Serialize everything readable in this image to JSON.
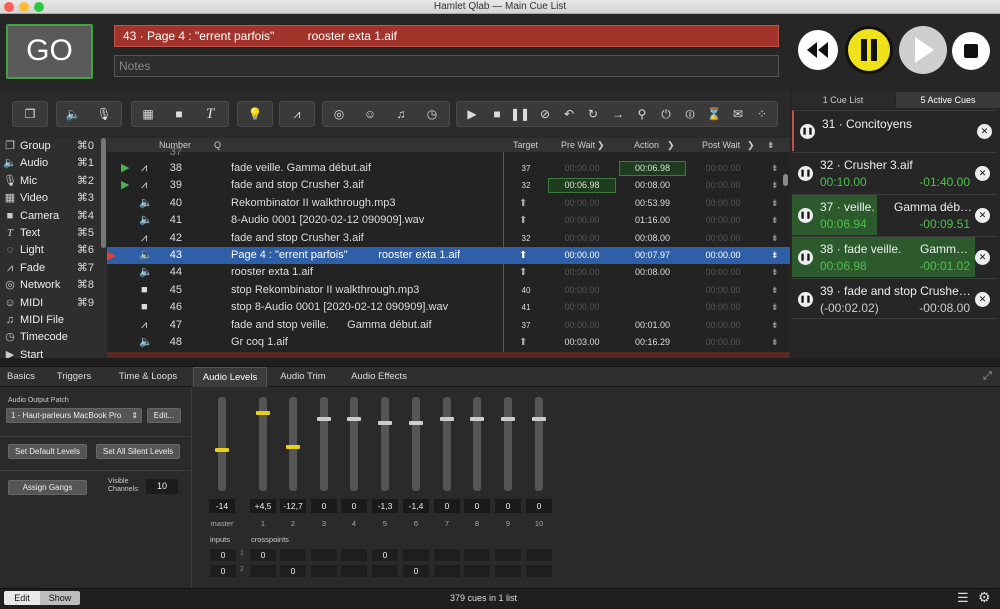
{
  "window": {
    "title": "Hamlet Qlab — Main Cue List"
  },
  "header": {
    "go_label": "GO",
    "standby_text": "43 · Page 4 : \"errent parfois\"          rooster exta 1.aif",
    "notes_placeholder": "Notes"
  },
  "sidebar": {
    "items": [
      {
        "label": "Group",
        "key": "⌘0",
        "icon": "group-icon"
      },
      {
        "label": "Audio",
        "key": "⌘1",
        "icon": "audio-icon"
      },
      {
        "label": "Mic",
        "key": "⌘2",
        "icon": "mic-icon"
      },
      {
        "label": "Video",
        "key": "⌘3",
        "icon": "video-icon"
      },
      {
        "label": "Camera",
        "key": "⌘4",
        "icon": "camera-icon"
      },
      {
        "label": "Text",
        "key": "⌘5",
        "icon": "text-icon"
      },
      {
        "label": "Light",
        "key": "⌘6",
        "icon": "light-icon"
      },
      {
        "label": "Fade",
        "key": "⌘7",
        "icon": "fade-icon"
      },
      {
        "label": "Network",
        "key": "⌘8",
        "icon": "network-icon"
      },
      {
        "label": "MIDI",
        "key": "⌘9",
        "icon": "midi-icon"
      },
      {
        "label": "MIDI File",
        "key": "",
        "icon": "midi-file-icon"
      },
      {
        "label": "Timecode",
        "key": "",
        "icon": "timecode-icon"
      },
      {
        "label": "Start",
        "key": "",
        "icon": "start-icon"
      }
    ]
  },
  "table": {
    "headers": {
      "number": "Number",
      "q": "Q",
      "target": "Target",
      "pre_wait": "Pre Wait",
      "action": "Action",
      "post_wait": "Post Wait"
    },
    "rows": [
      {
        "num": "37",
        "q": "",
        "target": "",
        "pre": "",
        "action": "",
        "post": ""
      },
      {
        "num": "38",
        "q": "fade veille.      Gamma début.aif",
        "target": "37",
        "pre": "00:00.00",
        "action": "00:06.98",
        "post": "00:00.00"
      },
      {
        "num": "39",
        "q": "fade and stop Crusher 3.aif",
        "target": "32",
        "pre": "00:06.98",
        "action": "00:08.00",
        "post": "00:00.00"
      },
      {
        "num": "40",
        "q": "Rekombinator II walkthrough.mp3",
        "target": "",
        "pre": "00:00.00",
        "action": "00:53.99",
        "post": "00:00.00"
      },
      {
        "num": "41",
        "q": "8-Audio 0001 [2020-02-12 090909].wav",
        "target": "",
        "pre": "00:00.00",
        "action": "01:16.00",
        "post": "00:00.00"
      },
      {
        "num": "42",
        "q": "fade and stop Crusher 3.aif",
        "target": "32",
        "pre": "00:00.00",
        "action": "00:08.00",
        "post": "00:00.00"
      },
      {
        "num": "43",
        "q": "Page 4 : \"errent parfois\"          rooster exta 1.aif",
        "target": "",
        "pre": "00:00.00",
        "action": "00:07.97",
        "post": "00:00.00"
      },
      {
        "num": "44",
        "q": "rooster exta 1.aif",
        "target": "",
        "pre": "00:00.00",
        "action": "00:08.00",
        "post": "00:00.00"
      },
      {
        "num": "45",
        "q": "stop Rekombinator II walkthrough.mp3",
        "target": "40",
        "pre": "00:00.00",
        "action": "",
        "post": "00:00.00"
      },
      {
        "num": "46",
        "q": "stop 8-Audio 0001 [2020-02-12 090909].wav",
        "target": "41",
        "pre": "00:00.00",
        "action": "",
        "post": "00:00.00"
      },
      {
        "num": "47",
        "q": "fade and stop veille.      Gamma début.aif",
        "target": "37",
        "pre": "00:00.00",
        "action": "00:01.00",
        "post": "00:00.00"
      },
      {
        "num": "48",
        "q": "Gr coq 1.aif",
        "target": "",
        "pre": "00:03.00",
        "action": "00:16.29",
        "post": "00:00.00"
      }
    ]
  },
  "active_panel": {
    "tab_cue_list": "1 Cue List",
    "tab_active": "5 Active Cues",
    "cues": [
      {
        "name": "31 · Concitoyens",
        "elapsed": "",
        "remaining": ""
      },
      {
        "name": "32 · Crusher 3.aif",
        "elapsed": "00:10.00",
        "remaining": "-01:40.00"
      },
      {
        "name": "37 · veille.",
        "name2": "Gamma déb…",
        "elapsed": "00:06.94",
        "remaining": "-00:09.51"
      },
      {
        "name": "38 · fade veille.",
        "name2": "Gamm…",
        "elapsed": "00:06.98",
        "remaining": "-00:01.02"
      },
      {
        "name": "39 · fade and stop Crushe…",
        "elapsed": "(-00:02.02)",
        "remaining": "-00:08.00"
      }
    ]
  },
  "inspector": {
    "tabs": [
      "Basics",
      "Triggers",
      "Time & Loops",
      "Audio Levels",
      "Audio Trim",
      "Audio Effects"
    ],
    "output_patch_label": "Audio Output Patch",
    "output_patch_value": "1 - Haut-parleurs MacBook Pro",
    "edit_label": "Edit...",
    "set_default_label": "Set Default Levels",
    "set_silent_label": "Set All Silent Levels",
    "assign_gangs_label": "Assign Gangs",
    "visible_channels_label": "Visible Channels:",
    "visible_channels_value": "10",
    "fader_values": [
      "-14",
      "+4,5",
      "-12,7",
      "0",
      "0",
      "-1,3",
      "-1,4",
      "0",
      "0",
      "0",
      "0"
    ],
    "fader_labels": [
      "master",
      "1",
      "2",
      "3",
      "4",
      "5",
      "6",
      "7",
      "8",
      "9",
      "10"
    ],
    "inputs_label": "inputs",
    "crosspoints_label": "crosspoints",
    "input_values": [
      "0",
      "0"
    ],
    "crosspoints_row1": [
      "0",
      "",
      "",
      "",
      "0",
      "",
      "",
      "",
      "",
      ""
    ],
    "crosspoints_row2": [
      "",
      "0",
      "",
      "",
      "",
      "0",
      "",
      "",
      "",
      ""
    ],
    "crosspoint_row_nums": [
      "1",
      "2"
    ]
  },
  "status": {
    "edit_label": "Edit",
    "show_label": "Show",
    "summary": "379 cues in 1 list"
  },
  "colors": {
    "go_border": "#3fa33f",
    "standby": "#a3342c",
    "selected_row": "#2f5fa6",
    "active_green": "#2d5a2d",
    "pause_yellow": "#f0e21a"
  }
}
